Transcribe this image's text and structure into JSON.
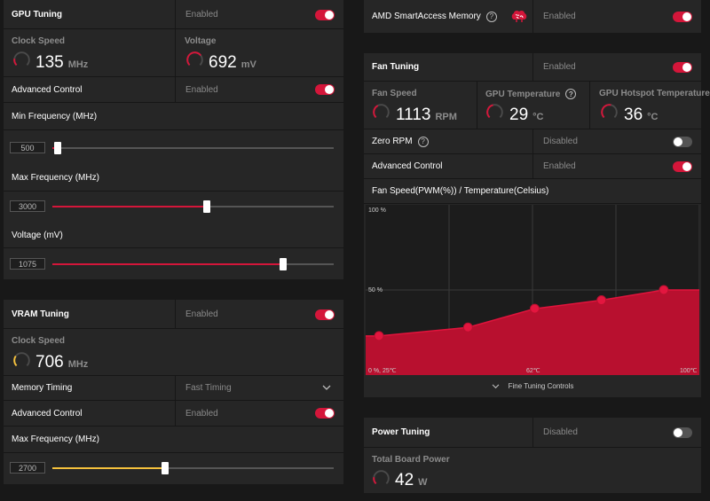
{
  "colors": {
    "accent": "#d4163a",
    "vram_accent": "#f5c13c",
    "panel": "#262626",
    "background": "#181818"
  },
  "gpu_tuning": {
    "title": "GPU Tuning",
    "status": "Enabled",
    "toggle_on": true,
    "clock_speed": {
      "label": "Clock Speed",
      "value": "135",
      "unit": "MHz",
      "gauge_fraction": 0.2
    },
    "voltage": {
      "label": "Voltage",
      "value": "692",
      "unit": "mV",
      "gauge_fraction": 0.7
    },
    "advanced_control": {
      "label": "Advanced Control",
      "status": "Enabled",
      "toggle_on": true
    },
    "min_frequency": {
      "label": "Min Frequency (MHz)",
      "value": "500",
      "fraction": 0.02
    },
    "max_frequency": {
      "label": "Max Frequency (MHz)",
      "value": "3000",
      "fraction": 0.55
    },
    "voltage_slider": {
      "label": "Voltage (mV)",
      "value": "1075",
      "fraction": 0.82
    }
  },
  "vram_tuning": {
    "title": "VRAM Tuning",
    "status": "Enabled",
    "toggle_on": true,
    "clock_speed": {
      "label": "Clock Speed",
      "value": "706",
      "unit": "MHz",
      "gauge_fraction": 0.3
    },
    "memory_timing": {
      "label": "Memory Timing",
      "value": "Fast Timing"
    },
    "advanced_control": {
      "label": "Advanced Control",
      "status": "Enabled",
      "toggle_on": true
    },
    "max_frequency": {
      "label": "Max Frequency (MHz)",
      "value": "2700",
      "fraction": 0.4
    }
  },
  "smart_access": {
    "label": "AMD SmartAccess Memory",
    "status": "Enabled",
    "toggle_on": true,
    "icon": "brain-icon"
  },
  "fan_tuning": {
    "title": "Fan Tuning",
    "status": "Enabled",
    "toggle_on": true,
    "fan_speed": {
      "label": "Fan Speed",
      "value": "1113",
      "unit": "RPM",
      "gauge_fraction": 0.4
    },
    "gpu_temperature": {
      "label": "GPU Temperature",
      "value": "29",
      "unit": "°C",
      "gauge_fraction": 0.45
    },
    "hotspot_temperature": {
      "label": "GPU Hotspot Temperature",
      "value": "36",
      "unit": "°C",
      "gauge_fraction": 0.55
    },
    "zero_rpm": {
      "label": "Zero RPM",
      "status": "Disabled",
      "toggle_on": false
    },
    "advanced_control": {
      "label": "Advanced Control",
      "status": "Enabled",
      "toggle_on": true
    },
    "fine_tuning_label": "Fine Tuning Controls"
  },
  "chart_data": {
    "type": "area",
    "title": "Fan Speed(PWM(%)) / Temperature(Celsius)",
    "y_top_label": "100 %",
    "y_mid_label": "50 %",
    "x_start_label": "0 %, 25℃",
    "x_mid_label": "62℃",
    "x_end_label": "100℃",
    "xlim": [
      25,
      100
    ],
    "ylim": [
      0,
      100
    ],
    "points": [
      {
        "x": 28,
        "y": 23
      },
      {
        "x": 48,
        "y": 28
      },
      {
        "x": 63,
        "y": 39
      },
      {
        "x": 78,
        "y": 44
      },
      {
        "x": 92,
        "y": 50
      }
    ],
    "end_y": 50
  },
  "power_tuning": {
    "title": "Power Tuning",
    "status": "Disabled",
    "toggle_on": false,
    "total_board_power": {
      "label": "Total Board Power",
      "value": "42",
      "unit": "W",
      "gauge_fraction": 0.2
    }
  }
}
